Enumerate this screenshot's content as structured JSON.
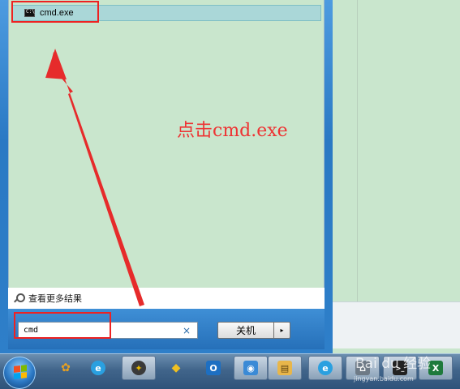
{
  "start_menu": {
    "result": {
      "label": "cmd.exe",
      "icon": "cmd-icon",
      "icon_glyph": "C:\\"
    },
    "more_results_label": "查看更多结果",
    "search": {
      "value": "cmd",
      "clear_glyph": "×"
    },
    "shutdown": {
      "label": "关机",
      "arrow_glyph": "▸"
    }
  },
  "annotation": {
    "text": "点击cmd.exe",
    "color": "#ee3333"
  },
  "taskbar": {
    "buttons": [
      {
        "icon": "shell-icon",
        "glyph": "✦",
        "color": "#e6b800"
      },
      {
        "icon": "messenger-icon",
        "glyph": "◆",
        "color": "#f0c020"
      },
      {
        "icon": "outlook-icon",
        "glyph": "O",
        "color": "#1d6fc2"
      },
      {
        "icon": "remote-desktop-icon",
        "glyph": "◉",
        "color": "#3a8ad6"
      },
      {
        "icon": "explorer-icon",
        "glyph": "▤",
        "color": "#e8b64a"
      },
      {
        "icon": "ie-icon",
        "glyph": "e",
        "color": "#2aa0e0"
      },
      {
        "icon": "network-icon",
        "glyph": "⌂",
        "color": "#6e7a86"
      },
      {
        "icon": "terminal-icon",
        "glyph": ">_",
        "color": "#222222"
      },
      {
        "icon": "excel-icon",
        "glyph": "X",
        "color": "#1e7a3c"
      }
    ],
    "quick": [
      {
        "icon": "windows-live-icon",
        "glyph": "✿"
      },
      {
        "icon": "ie-quick-icon",
        "glyph": "e"
      }
    ]
  },
  "watermark": {
    "text": "Bai du 经验",
    "sub": "jingyan.baidu.com"
  },
  "colors": {
    "accent_red": "#e22222",
    "taskbar": "#41658b",
    "panel": "#c9e6cd"
  }
}
